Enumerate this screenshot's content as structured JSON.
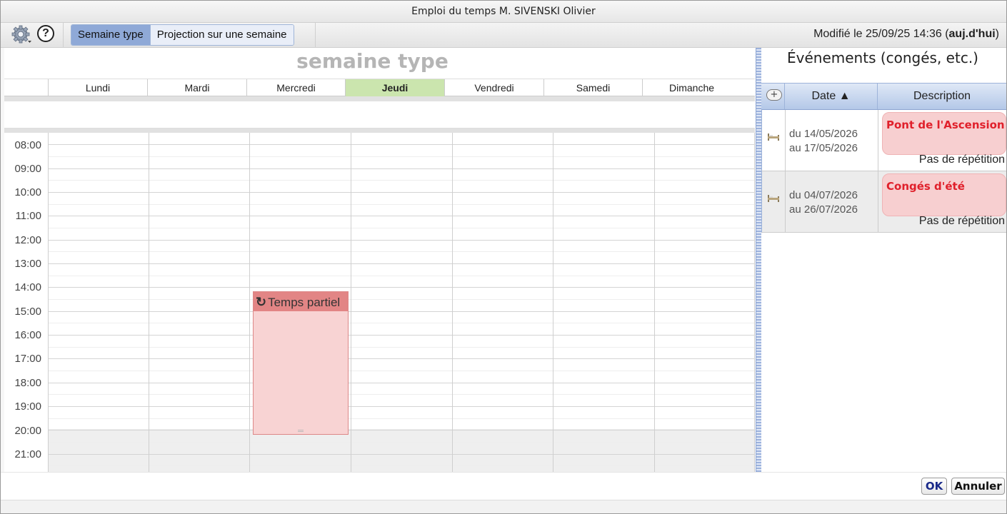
{
  "window": {
    "title": "Emploi du temps M. SIVENSKI Olivier"
  },
  "toolbar": {
    "settings_icon": "gear-icon",
    "help_icon": "help-icon",
    "help_glyph": "?",
    "view_modes": [
      {
        "label": "Semaine type",
        "selected": true
      },
      {
        "label": "Projection sur une semaine",
        "selected": false
      }
    ],
    "modified_prefix": "Modifié le 25/09/25 14:36 (",
    "modified_bold": "auj.d'hui",
    "modified_suffix": ")"
  },
  "schedule": {
    "title": "semaine type",
    "days": [
      "Lundi",
      "Mardi",
      "Mercredi",
      "Jeudi",
      "Vendredi",
      "Samedi",
      "Dimanche"
    ],
    "today": "Jeudi",
    "hours": [
      "08:00",
      "09:00",
      "10:00",
      "11:00",
      "12:00",
      "13:00",
      "14:00",
      "15:00",
      "16:00",
      "17:00",
      "18:00",
      "19:00",
      "20:00",
      "21:00"
    ],
    "events": [
      {
        "title": "Temps partiel",
        "day": "Mercredi",
        "start": "14:00",
        "end": "20:00",
        "recurring": true,
        "color": "#e28585"
      }
    ]
  },
  "events_panel": {
    "title": "Événements (congés, etc.)",
    "add_label": "+",
    "columns": {
      "date": "Date ▲",
      "description": "Description"
    },
    "rows": [
      {
        "from": "du 14/05/2026",
        "to": "au 17/05/2026",
        "name": "Pont de l'Ascension",
        "repeat": "Pas de répétition"
      },
      {
        "from": "du 04/07/2026",
        "to": "au 26/07/2026",
        "name": "Congés d'été",
        "repeat": "Pas de répétition"
      }
    ]
  },
  "footer": {
    "ok_label": "OK",
    "cancel_label": "Annuler"
  },
  "colors": {
    "today": "#cbe5ae",
    "event": "#f8d3d3",
    "accent": "#8fa9d7",
    "holiday_text": "#e0202b"
  }
}
